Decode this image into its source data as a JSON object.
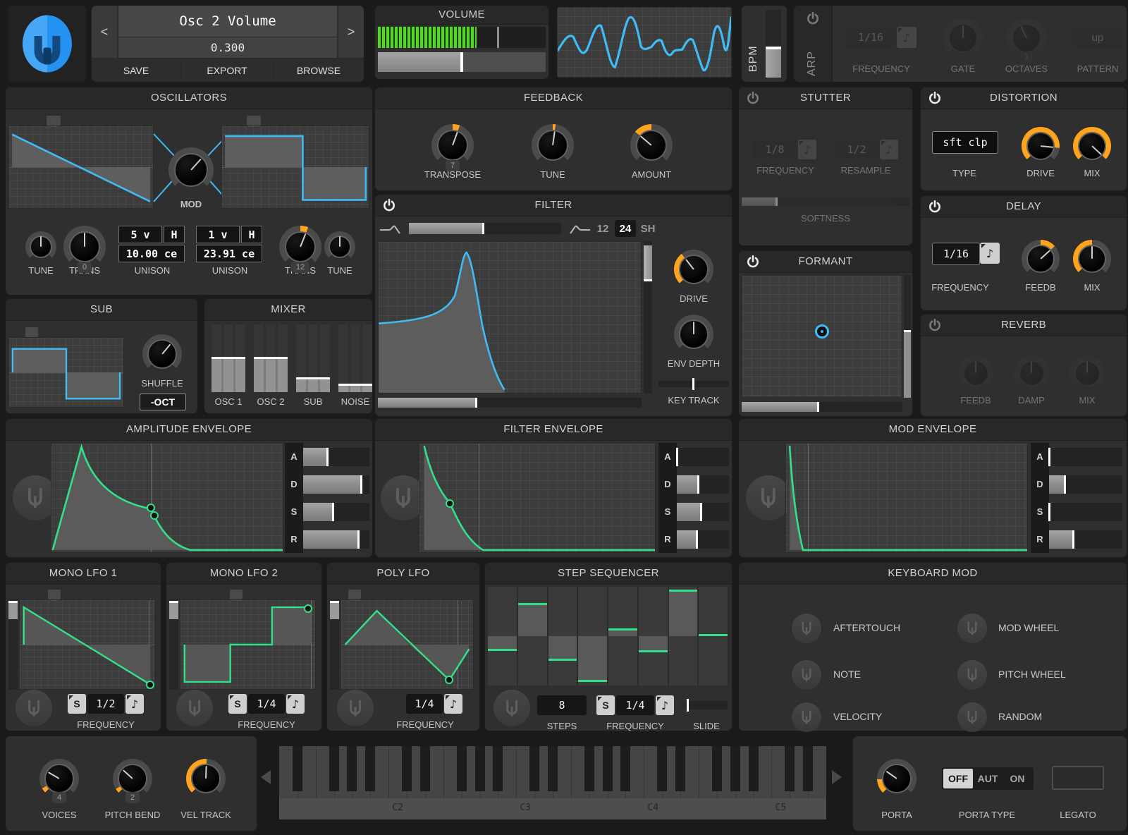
{
  "colors": {
    "accent_blue": "#3fbcf4",
    "accent_green": "#33e08a",
    "accent_orange": "#ffa41c",
    "meter_green": "#56d42a"
  },
  "header": {
    "patch_prev": "<",
    "patch_next": ">",
    "patch_name": "Osc 2 Volume",
    "patch_value": "0.300",
    "save": "SAVE",
    "export": "EXPORT",
    "browse": "BROWSE",
    "volume_title": "VOLUME",
    "bpm_label": "BPM",
    "arp": {
      "label": "ARP",
      "freq_value": "1/16",
      "note": "♪",
      "freq_label": "FREQUENCY",
      "gate_label": "GATE",
      "octaves_value": "1",
      "octaves_label": "OCTAVES",
      "pattern_value": "up",
      "pattern_label": "PATTERN"
    }
  },
  "oscillators": {
    "title": "OSCILLATORS",
    "mod_label": "MOD",
    "tune1_label": "TUNE",
    "trans1_label": "TRANS",
    "trans1_value": "0",
    "unison1": {
      "voices": "5 v",
      "h": "H",
      "cents": "10.00 ce",
      "label": "UNISON"
    },
    "unison2": {
      "voices": "1 v",
      "h": "H",
      "cents": "23.91 ce",
      "label": "UNISON"
    },
    "trans2_label": "TRANS",
    "trans2_value": "12",
    "tune2_label": "TUNE"
  },
  "feedback": {
    "title": "FEEDBACK",
    "transpose_label": "TRANSPOSE",
    "transpose_value": "7",
    "tune_label": "TUNE",
    "amount_label": "AMOUNT"
  },
  "filter": {
    "title": "FILTER",
    "pole12": "12",
    "pole24": "24",
    "polesh": "SH",
    "drive_label": "DRIVE",
    "env_depth_label": "ENV DEPTH",
    "key_track_label": "KEY TRACK"
  },
  "stutter": {
    "title": "STUTTER",
    "freq_value": "1/8",
    "note": "♪",
    "freq_label": "FREQUENCY",
    "resample_value": "1/2",
    "resample_label": "RESAMPLE",
    "softness_label": "SOFTNESS"
  },
  "distortion": {
    "title": "DISTORTION",
    "type_value": "sft clp",
    "type_label": "TYPE",
    "drive_label": "DRIVE",
    "mix_label": "MIX"
  },
  "delay": {
    "title": "DELAY",
    "freq_value": "1/16",
    "note": "♪",
    "freq_label": "FREQUENCY",
    "feedb_label": "FEEDB",
    "mix_label": "MIX"
  },
  "formant": {
    "title": "FORMANT"
  },
  "reverb": {
    "title": "REVERB",
    "feedb_label": "FEEDB",
    "damp_label": "DAMP",
    "mix_label": "MIX"
  },
  "sub": {
    "title": "SUB",
    "shuffle_label": "SHUFFLE",
    "oct_button": "-OCT"
  },
  "mixer": {
    "title": "MIXER",
    "channels": [
      {
        "label": "OSC 1",
        "level": 0.52
      },
      {
        "label": "OSC 2",
        "level": 0.52
      },
      {
        "label": "SUB",
        "level": 0.22
      },
      {
        "label": "NOISE",
        "level": 0.13
      }
    ]
  },
  "envelopes": {
    "letters": [
      "A",
      "D",
      "S",
      "R"
    ],
    "amp": {
      "title": "AMPLITUDE ENVELOPE",
      "values": [
        0.38,
        0.89,
        0.47,
        0.85
      ]
    },
    "filter": {
      "title": "FILTER ENVELOPE",
      "values": [
        0.03,
        0.43,
        0.48,
        0.4
      ]
    },
    "mod": {
      "title": "MOD ENVELOPE",
      "values": [
        0.02,
        0.23,
        0.02,
        0.35
      ]
    }
  },
  "lfo1": {
    "title": "MONO LFO 1",
    "sync": "S",
    "freq_value": "1/2",
    "note": "♪",
    "freq_label": "FREQUENCY"
  },
  "lfo2": {
    "title": "MONO LFO 2",
    "sync": "S",
    "freq_value": "1/4",
    "note": "♪",
    "freq_label": "FREQUENCY"
  },
  "poly_lfo": {
    "title": "POLY LFO",
    "freq_value": "1/4",
    "note": "♪",
    "freq_label": "FREQUENCY"
  },
  "step_sequencer": {
    "title": "STEP SEQUENCER",
    "steps_value": "8",
    "steps_label": "STEPS",
    "sync": "S",
    "freq_value": "1/4",
    "note": "♪",
    "freq_label": "FREQUENCY",
    "slide_label": "SLIDE",
    "values": [
      -0.3,
      0.67,
      -0.5,
      -0.92,
      0.16,
      -0.32,
      0.95,
      0.05
    ]
  },
  "keyboard_mod": {
    "title": "KEYBOARD MOD",
    "items": [
      "AFTERTOUCH",
      "NOTE",
      "VELOCITY",
      "MOD WHEEL",
      "PITCH WHEEL",
      "RANDOM"
    ]
  },
  "voice": {
    "voices_label": "VOICES",
    "voices_value": "4",
    "pitch_bend_label": "PITCH BEND",
    "pitch_bend_value": "2",
    "vel_track_label": "VEL TRACK"
  },
  "keyboard": {
    "octave_labels": [
      "C2",
      "C3",
      "C4",
      "C5"
    ]
  },
  "porta": {
    "label": "PORTA",
    "type_label": "PORTA TYPE",
    "off": "OFF",
    "aut": "AUT",
    "on": "ON",
    "legato_label": "LEGATO"
  }
}
